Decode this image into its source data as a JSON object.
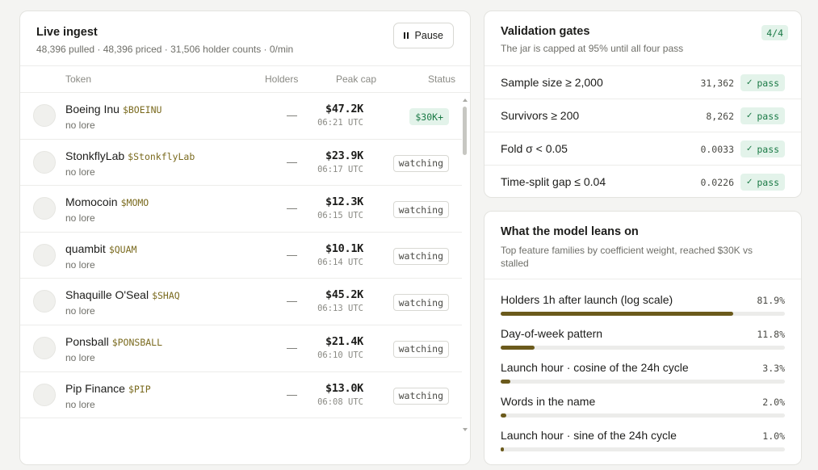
{
  "ingest": {
    "title": "Live ingest",
    "subtitle": "48,396 pulled · 48,396 priced · 31,506 holder counts · 0/min",
    "pause_label": "Pause",
    "columns": {
      "token": "Token",
      "holders": "Holders",
      "peak": "Peak cap",
      "status": "Status"
    },
    "rows": [
      {
        "name": "Boeing Inu",
        "ticker": "$BOEINU",
        "lore": "no lore",
        "holders": "—",
        "peak": "$47.2K",
        "time": "06:21 UTC",
        "status": "$30K+",
        "status_kind": "hit"
      },
      {
        "name": "StonkflyLab",
        "ticker": "$StonkflyLab",
        "lore": "no lore",
        "holders": "—",
        "peak": "$23.9K",
        "time": "06:17 UTC",
        "status": "watching",
        "status_kind": "watching"
      },
      {
        "name": "Momocoin",
        "ticker": "$MOMO",
        "lore": "no lore",
        "holders": "—",
        "peak": "$12.3K",
        "time": "06:15 UTC",
        "status": "watching",
        "status_kind": "watching"
      },
      {
        "name": "quambit",
        "ticker": "$QUAM",
        "lore": "no lore",
        "holders": "—",
        "peak": "$10.1K",
        "time": "06:14 UTC",
        "status": "watching",
        "status_kind": "watching"
      },
      {
        "name": "Shaquille O'Seal",
        "ticker": "$SHAQ",
        "lore": "no lore",
        "holders": "—",
        "peak": "$45.2K",
        "time": "06:13 UTC",
        "status": "watching",
        "status_kind": "watching"
      },
      {
        "name": "Ponsball",
        "ticker": "$PONSBALL",
        "lore": "no lore",
        "holders": "—",
        "peak": "$21.4K",
        "time": "06:10 UTC",
        "status": "watching",
        "status_kind": "watching"
      },
      {
        "name": "Pip Finance",
        "ticker": "$PIP",
        "lore": "no lore",
        "holders": "—",
        "peak": "$13.0K",
        "time": "06:08 UTC",
        "status": "watching",
        "status_kind": "watching"
      }
    ]
  },
  "gates": {
    "title": "Validation gates",
    "subtitle": "The jar is capped at 95% until all four pass",
    "count": "4/4",
    "items": [
      {
        "label": "Sample size ≥ 2,000",
        "value": "31,362",
        "result": "pass"
      },
      {
        "label": "Survivors ≥ 200",
        "value": "8,262",
        "result": "pass"
      },
      {
        "label": "Fold σ < 0.05",
        "value": "0.0033",
        "result": "pass"
      },
      {
        "label": "Time-split gap ≤ 0.04",
        "value": "0.0226",
        "result": "pass"
      }
    ]
  },
  "leans": {
    "title": "What the model leans on",
    "subtitle": "Top feature families by coefficient weight, reached $30K vs stalled",
    "features": [
      {
        "label": "Holders 1h after launch (log scale)",
        "pct": "81.9%",
        "fraction": 0.819
      },
      {
        "label": "Day-of-week pattern",
        "pct": "11.8%",
        "fraction": 0.118
      },
      {
        "label": "Launch hour · cosine of the 24h cycle",
        "pct": "3.3%",
        "fraction": 0.033
      },
      {
        "label": "Words in the name",
        "pct": "2.0%",
        "fraction": 0.02
      },
      {
        "label": "Launch hour · sine of the 24h cycle",
        "pct": "1.0%",
        "fraction": 0.01
      }
    ]
  },
  "colors": {
    "accent": "#6b5a1c",
    "pass_bg": "#e3f3ea",
    "pass_text": "#1b7a46",
    "ticker": "#7a6a1e"
  },
  "icons": {
    "pause": "pause-icon",
    "check": "check-icon"
  }
}
